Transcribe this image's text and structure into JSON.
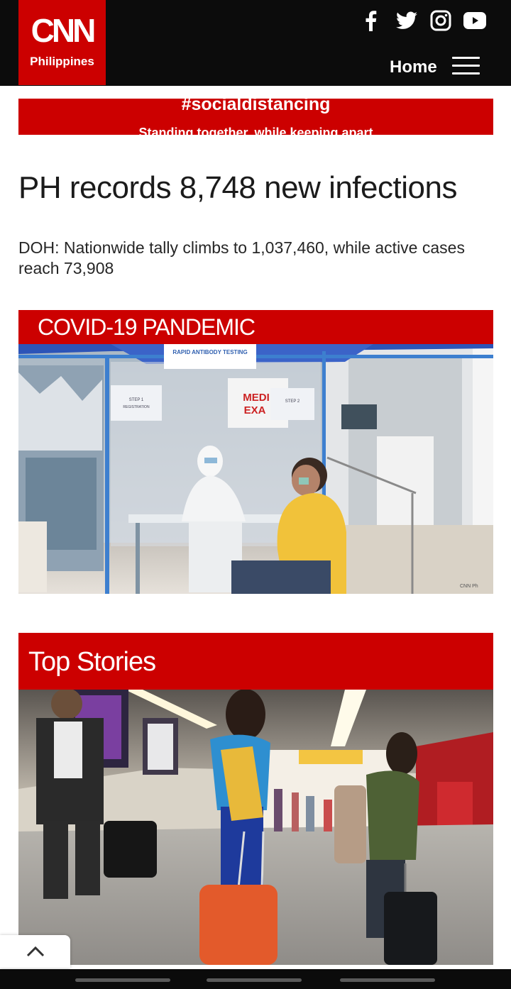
{
  "header": {
    "brand": "CNN",
    "brand_sub": "Philippines",
    "social": [
      {
        "icon": "facebook-icon"
      },
      {
        "icon": "twitter-icon"
      },
      {
        "icon": "instagram-icon"
      },
      {
        "icon": "youtube-icon"
      }
    ],
    "home_label": "Home",
    "menu_icon": "hamburger-menu-icon"
  },
  "banner": {
    "title": "#socialdistancing",
    "subtitle": "Standing together, while keeping apart"
  },
  "article": {
    "headline": "PH records 8,748 new infections",
    "subheadline": "DOH: Nationwide tally climbs to 1,037,460, while active cases reach 73,908"
  },
  "sections": {
    "covid": {
      "title": "COVID-19 PANDEMIC",
      "photo_credit": "CNN Ph"
    },
    "top_stories": {
      "title": "Top Stories"
    }
  },
  "photo_signs": {
    "testing": "RAPID ANTIBODY TESTING",
    "medical": "MEDI",
    "exam": "EXA",
    "step1": "STEP 1",
    "registration": "REGISTRATION",
    "step2": "STEP 2"
  },
  "colors": {
    "brand_red": "#cc0000",
    "header_bg": "#0c0c0c"
  },
  "controls": {
    "back_to_top_icon": "chevron-up-icon"
  }
}
